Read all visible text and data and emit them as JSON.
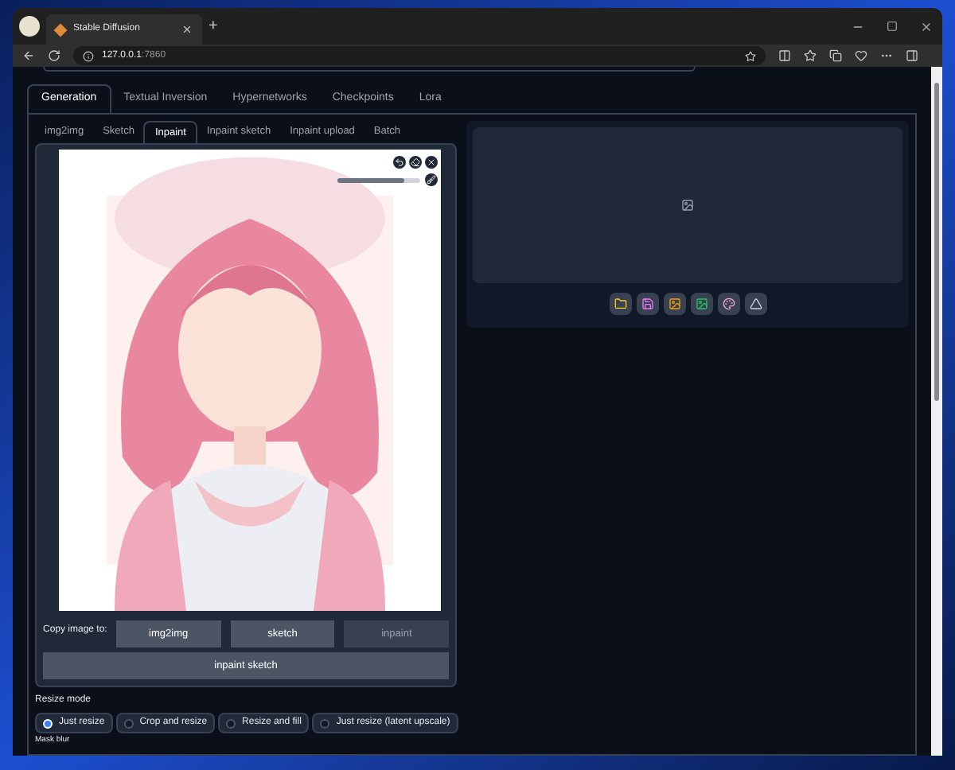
{
  "browser": {
    "tab_title": "Stable Diffusion",
    "new_tab": "+",
    "address_host": "127.0.0.1",
    "address_port": ":7860"
  },
  "main_tabs": [
    {
      "label": "Generation",
      "selected": true
    },
    {
      "label": "Textual Inversion",
      "selected": false
    },
    {
      "label": "Hypernetworks",
      "selected": false
    },
    {
      "label": "Checkpoints",
      "selected": false
    },
    {
      "label": "Lora",
      "selected": false
    }
  ],
  "mode_tabs": [
    {
      "label": "img2img",
      "selected": false
    },
    {
      "label": "Sketch",
      "selected": false
    },
    {
      "label": "Inpaint",
      "selected": true
    },
    {
      "label": "Inpaint sketch",
      "selected": false
    },
    {
      "label": "Inpaint upload",
      "selected": false
    },
    {
      "label": "Batch",
      "selected": false
    }
  ],
  "canvas": {
    "brush_size": {
      "level": 0.8
    }
  },
  "copy_image": {
    "label": "Copy image to:",
    "buttons": [
      {
        "label": "img2img",
        "disabled": false
      },
      {
        "label": "sketch",
        "disabled": false
      },
      {
        "label": "inpaint",
        "disabled": true
      }
    ],
    "wide_button": "inpaint sketch"
  },
  "resize_mode": {
    "label": "Resize mode",
    "options": [
      {
        "label": "Just resize",
        "selected": true
      },
      {
        "label": "Crop and resize",
        "selected": false
      },
      {
        "label": "Resize and fill",
        "selected": false
      },
      {
        "label": "Just resize (latent upscale)",
        "selected": false
      }
    ]
  },
  "mask_blur": {
    "label": "Mask blur"
  }
}
